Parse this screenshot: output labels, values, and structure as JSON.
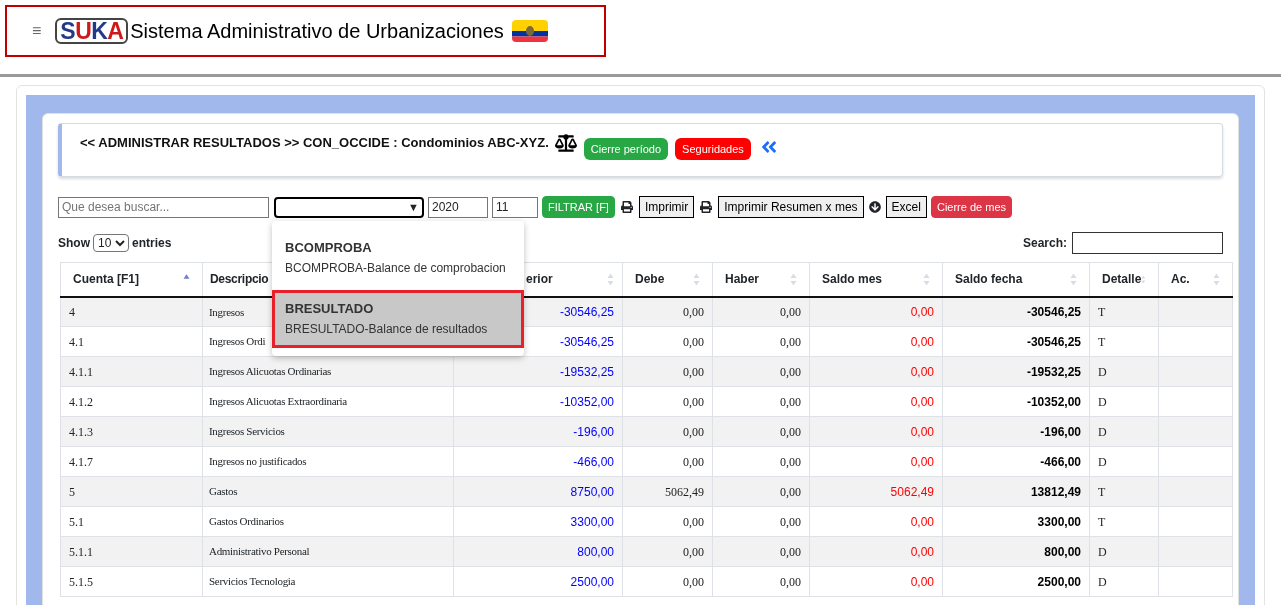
{
  "header": {
    "menu_icon": "≡",
    "logo": "SUKA",
    "title": "Sistema Administrativo de Urbanizaciones"
  },
  "panel": {
    "title": "<< ADMINISTRAR RESULTADOS >> CON_OCCIDE : Condominios ABC-XYZ.",
    "badges": [
      {
        "label": "Cierre período",
        "color": "#28a745"
      },
      {
        "label": "Seguridades",
        "color": "#ff0000"
      }
    ]
  },
  "toolbar": {
    "search": {
      "placeholder": "Que desea buscar..."
    },
    "report_select": {
      "caret": "▼"
    },
    "year": "2020",
    "month": "11",
    "buttons": [
      {
        "kind": "green",
        "label": "FILTRAR [F]"
      },
      {
        "kind": "print",
        "label": "Imprimir"
      },
      {
        "kind": "print",
        "label": "Imprimir Resumen x mes"
      },
      {
        "kind": "download",
        "label": "Excel"
      },
      {
        "kind": "red",
        "label": "Cierre de mes"
      }
    ]
  },
  "dropdown": {
    "options": [
      {
        "code": "BCOMPROBA",
        "description": "BCOMPROBA-Balance de comprobacion",
        "selected": false
      },
      {
        "code": "BRESULTADO",
        "description": "BRESULTADO-Balance de resultados",
        "selected": true
      }
    ]
  },
  "entries": {
    "show": "Show",
    "value": "10",
    "suffix": "entries"
  },
  "search": {
    "label": "Search:"
  },
  "table": {
    "columns": [
      {
        "label": "Cuenta [F1]",
        "sorted": true
      },
      {
        "label": "Descripcio"
      },
      {
        "label": "erior",
        "sorted": false
      },
      {
        "label": "Debe",
        "sorted": false
      },
      {
        "label": "Haber",
        "sorted": false
      },
      {
        "label": "Saldo mes",
        "sorted": false
      },
      {
        "label": "Saldo fecha",
        "sorted": false
      },
      {
        "label": "Detalle",
        "sorted": false
      },
      {
        "label": "Ac.",
        "sorted": false
      }
    ],
    "rows": [
      {
        "cuenta": "4",
        "descripcion": "Ingresos",
        "anterior": "-30546,25",
        "debe": "0,00",
        "haber": "0,00",
        "saldo_mes": "0,00",
        "saldo_fecha": "-30546,25",
        "detalle": "T"
      },
      {
        "cuenta": "4.1",
        "descripcion": "Ingresos Ordi",
        "anterior": "-30546,25",
        "debe": "0,00",
        "haber": "0,00",
        "saldo_mes": "0,00",
        "saldo_fecha": "-30546,25",
        "detalle": "T"
      },
      {
        "cuenta": "4.1.1",
        "descripcion": "Ingresos Alicuotas Ordinarias",
        "anterior": "-19532,25",
        "debe": "0,00",
        "haber": "0,00",
        "saldo_mes": "0,00",
        "saldo_fecha": "-19532,25",
        "detalle": "D"
      },
      {
        "cuenta": "4.1.2",
        "descripcion": "Ingresos Alicuotas Extraordinaria",
        "anterior": "-10352,00",
        "debe": "0,00",
        "haber": "0,00",
        "saldo_mes": "0,00",
        "saldo_fecha": "-10352,00",
        "detalle": "D"
      },
      {
        "cuenta": "4.1.3",
        "descripcion": "Ingresos Servicios",
        "anterior": "-196,00",
        "debe": "0,00",
        "haber": "0,00",
        "saldo_mes": "0,00",
        "saldo_fecha": "-196,00",
        "detalle": "D"
      },
      {
        "cuenta": "4.1.7",
        "descripcion": "Ingresos no justificados",
        "anterior": "-466,00",
        "debe": "0,00",
        "haber": "0,00",
        "saldo_mes": "0,00",
        "saldo_fecha": "-466,00",
        "detalle": "D"
      },
      {
        "cuenta": "5",
        "descripcion": "Gastos",
        "anterior": "8750,00",
        "debe": "5062,49",
        "haber": "0,00",
        "saldo_mes": "5062,49",
        "saldo_fecha": "13812,49",
        "detalle": "T"
      },
      {
        "cuenta": "5.1",
        "descripcion": "Gastos Ordinarios",
        "anterior": "3300,00",
        "debe": "0,00",
        "haber": "0,00",
        "saldo_mes": "0,00",
        "saldo_fecha": "3300,00",
        "detalle": "T"
      },
      {
        "cuenta": "5.1.1",
        "descripcion": "Administrativo Personal",
        "anterior": "800,00",
        "debe": "0,00",
        "haber": "0,00",
        "saldo_mes": "0,00",
        "saldo_fecha": "800,00",
        "detalle": "D"
      },
      {
        "cuenta": "5.1.5",
        "descripcion": "Servicios Tecnologia",
        "anterior": "2500,00",
        "debe": "0,00",
        "haber": "0,00",
        "saldo_mes": "0,00",
        "saldo_fecha": "2500,00",
        "detalle": "D"
      }
    ]
  }
}
